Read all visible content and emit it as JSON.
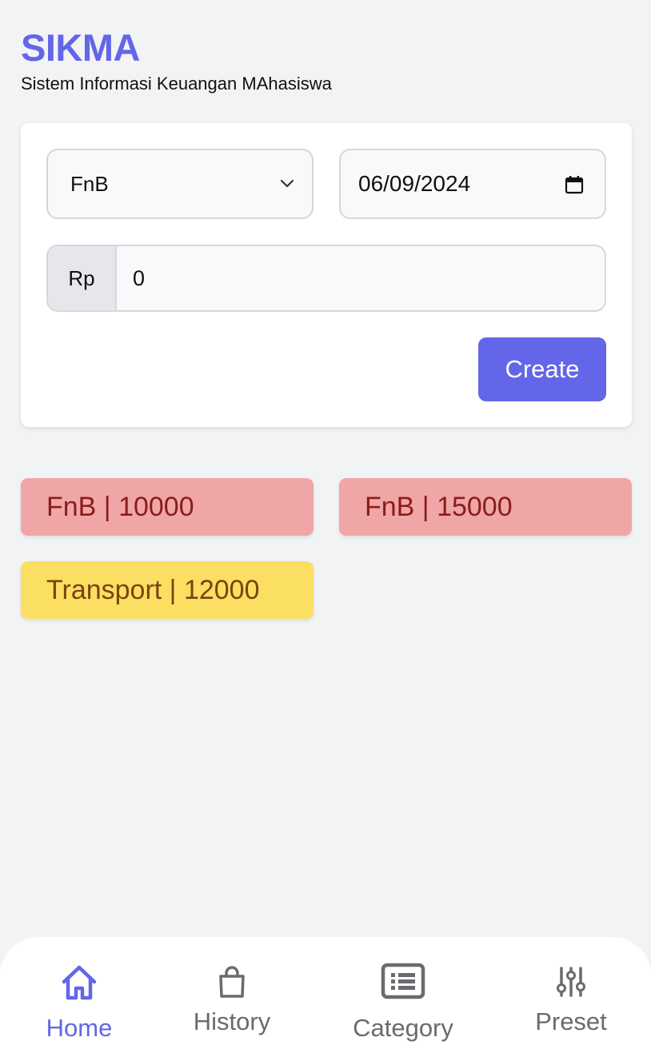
{
  "header": {
    "title": "SIKMA",
    "subtitle": "Sistem Informasi Keuangan MAhasiswa"
  },
  "form": {
    "category_value": "FnB",
    "date_value": "06/09/2024",
    "currency_prefix": "Rp",
    "amount_value": "0",
    "create_label": "Create"
  },
  "entries": [
    {
      "text": "FnB | 10000",
      "category": "FnB"
    },
    {
      "text": "FnB | 15000",
      "category": "FnB"
    },
    {
      "text": "Transport | 12000",
      "category": "Transport"
    }
  ],
  "nav": {
    "home": "Home",
    "history": "History",
    "category": "Category",
    "preset": "Preset"
  },
  "colors": {
    "accent": "#6366e8",
    "fnb_bg": "#f0a6a6",
    "fnb_text": "#8b1c1c",
    "transport_bg": "#fadf63",
    "transport_text": "#7a4310"
  },
  "icons": [
    "chevron-down-icon",
    "calendar-icon",
    "home-icon",
    "shopping-bag-icon",
    "list-icon",
    "sliders-icon"
  ]
}
